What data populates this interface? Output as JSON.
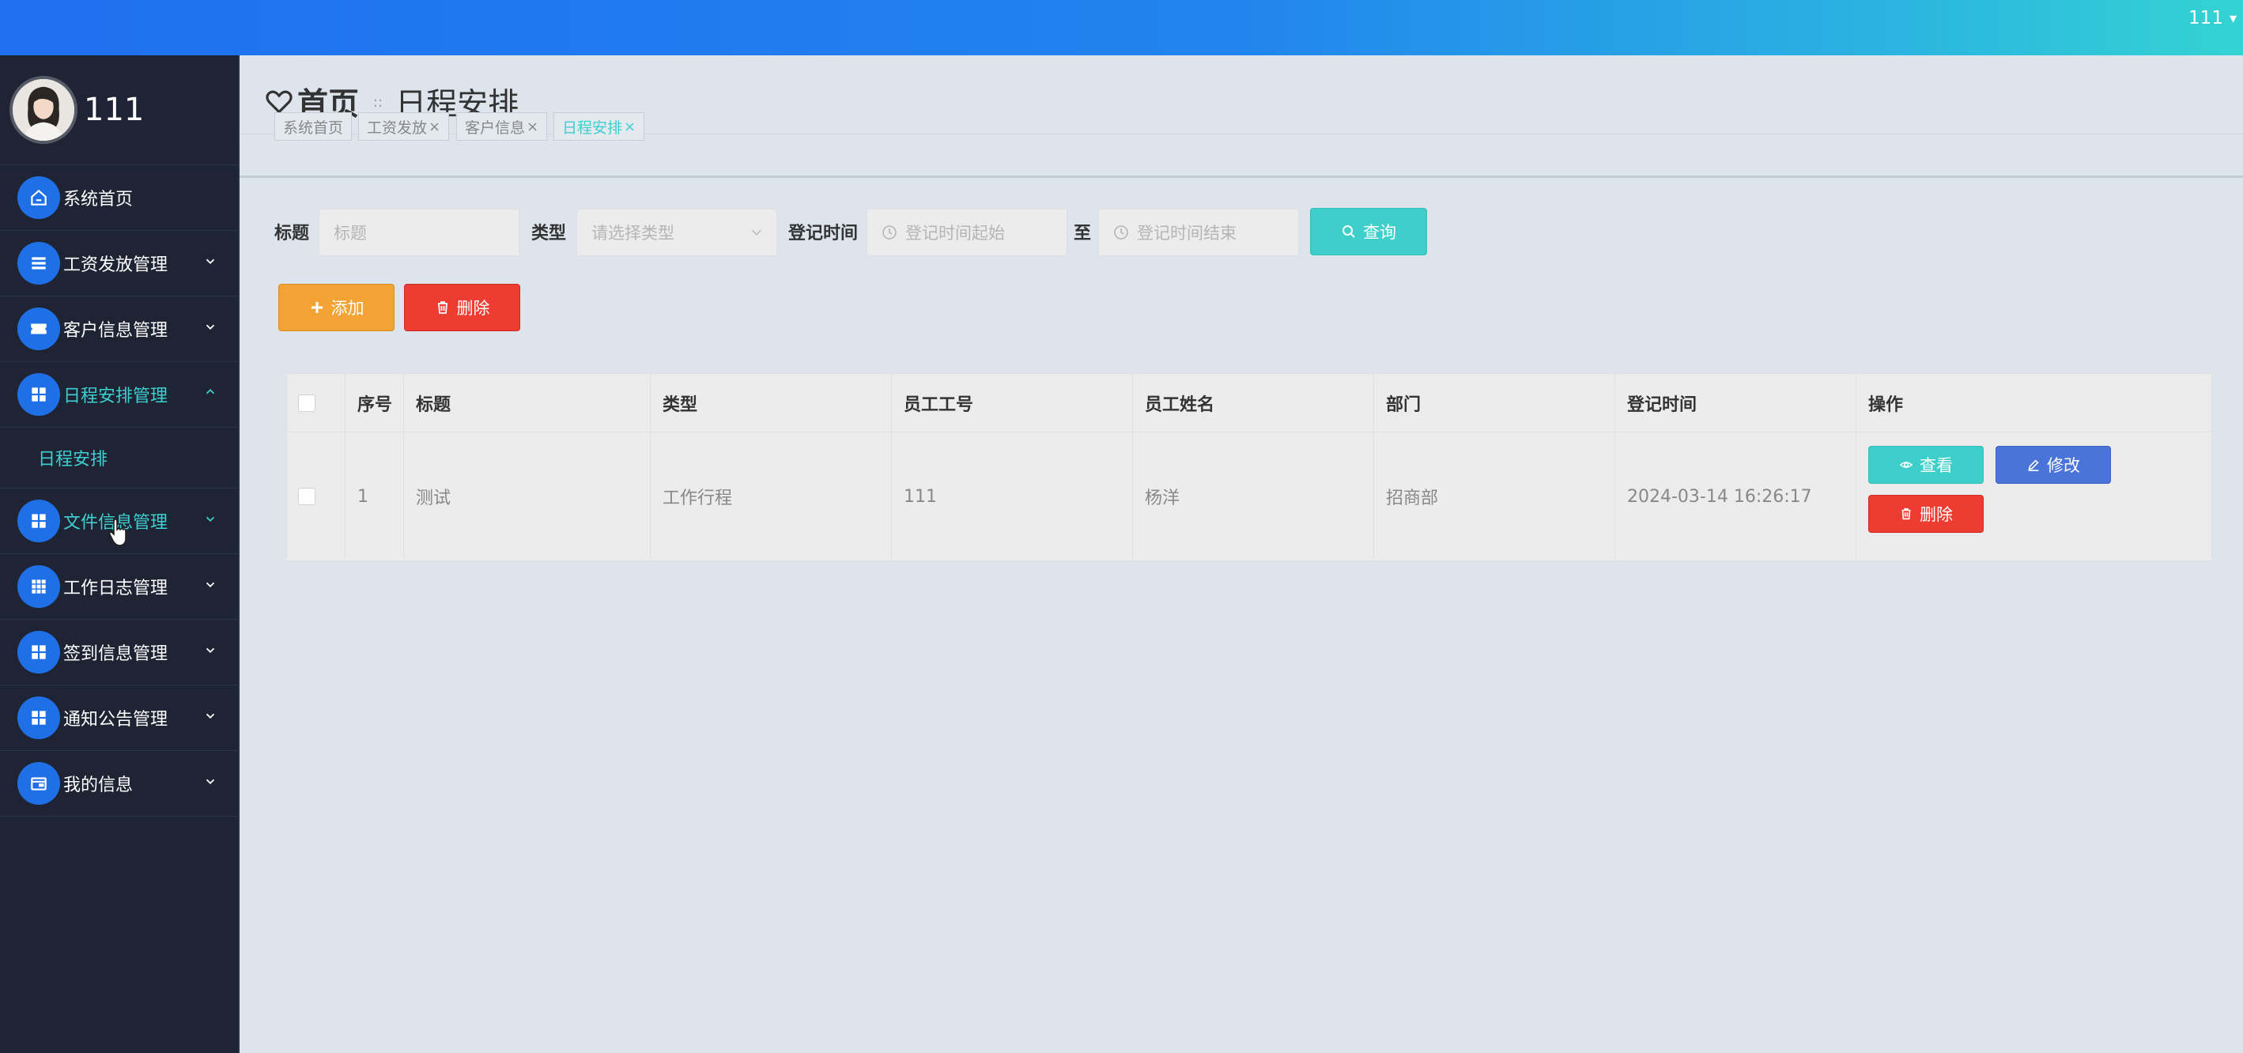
{
  "topbar": {
    "user": "111"
  },
  "sidebar": {
    "username": "111",
    "items": [
      {
        "label": "系统首页",
        "icon": "home-icon",
        "has_chevron": false
      },
      {
        "label": "工资发放管理",
        "icon": "list-icon",
        "has_chevron": true
      },
      {
        "label": "客户信息管理",
        "icon": "ticket-icon",
        "has_chevron": true
      },
      {
        "label": "日程安排管理",
        "icon": "grid-icon",
        "has_chevron": true,
        "expanded": true
      },
      {
        "label": "文件信息管理",
        "icon": "grid-icon",
        "has_chevron": true
      },
      {
        "label": "工作日志管理",
        "icon": "table-icon",
        "has_chevron": true
      },
      {
        "label": "签到信息管理",
        "icon": "grid-icon",
        "has_chevron": true
      },
      {
        "label": "通知公告管理",
        "icon": "grid-icon",
        "has_chevron": true
      },
      {
        "label": "我的信息",
        "icon": "wallet-icon",
        "has_chevron": true
      }
    ],
    "subitem": "日程安排"
  },
  "breadcrumb": {
    "home": "首页",
    "separator": "::",
    "current": "日程安排"
  },
  "tabs": [
    {
      "label": "系统首页",
      "closable": false
    },
    {
      "label": "工资发放",
      "closable": true
    },
    {
      "label": "客户信息",
      "closable": true
    },
    {
      "label": "日程安排",
      "closable": true,
      "active": true
    }
  ],
  "filters": {
    "title_label": "标题",
    "title_placeholder": "标题",
    "type_label": "类型",
    "type_placeholder": "请选择类型",
    "time_label": "登记时间",
    "time_start_placeholder": "登记时间起始",
    "to_label": "至",
    "time_end_placeholder": "登记时间结束",
    "query_button": "查询"
  },
  "actions": {
    "add": "添加",
    "delete": "删除"
  },
  "table": {
    "headers": [
      "序号",
      "标题",
      "类型",
      "员工工号",
      "员工姓名",
      "部门",
      "登记时间",
      "操作"
    ],
    "rows": [
      {
        "index": "1",
        "title": "测试",
        "type": "工作行程",
        "emp_no": "111",
        "emp_name": "杨洋",
        "dept": "招商部",
        "time": "2024-03-14 16:26:17"
      }
    ],
    "row_buttons": {
      "view": "查看",
      "edit": "修改",
      "delete": "删除"
    }
  },
  "colors": {
    "accent": "#3ecfd0",
    "primary": "#1f6fe6",
    "warning": "#f3a333",
    "danger": "#ee3c33",
    "edit": "#4a74d8"
  }
}
